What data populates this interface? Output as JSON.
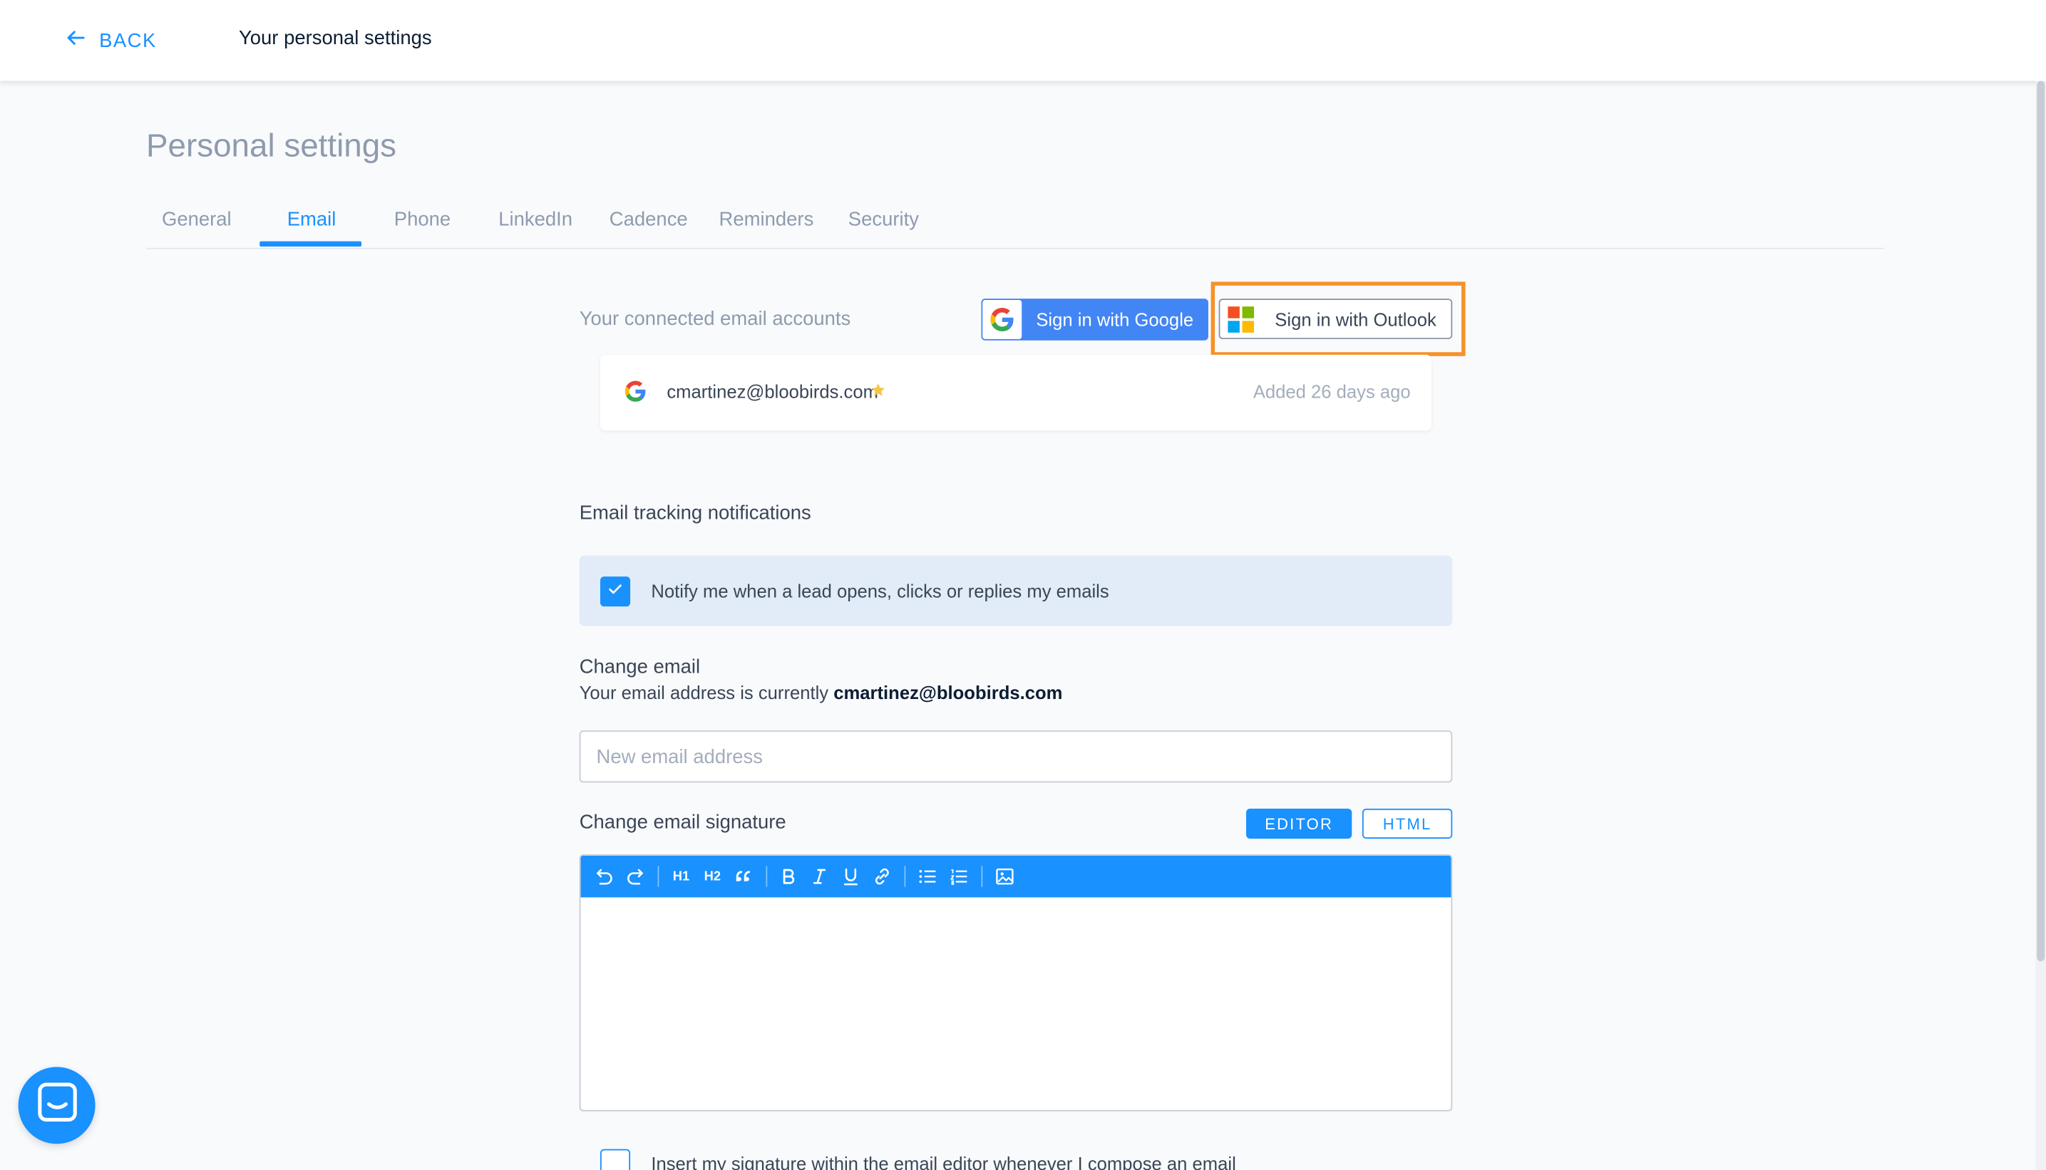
{
  "topbar": {
    "back_label": "BACK",
    "title": "Your personal settings"
  },
  "page": {
    "title": "Personal settings"
  },
  "tabs": [
    {
      "label": "General",
      "active": false
    },
    {
      "label": "Email",
      "active": true
    },
    {
      "label": "Phone",
      "active": false
    },
    {
      "label": "LinkedIn",
      "active": false
    },
    {
      "label": "Cadence",
      "active": false
    },
    {
      "label": "Reminders",
      "active": false
    },
    {
      "label": "Security",
      "active": false
    }
  ],
  "connected": {
    "label": "Your connected email accounts",
    "google_button": "Sign in with Google",
    "outlook_button": "Sign in with Outlook",
    "accounts": [
      {
        "email": "cmartinez@bloobirds.com",
        "added": "Added 26 days ago",
        "provider": "google-icon",
        "default": true
      }
    ]
  },
  "tracking": {
    "heading": "Email tracking notifications",
    "notify_label": "Notify me when a lead opens, clicks or replies my emails",
    "notify_checked": true
  },
  "change_email": {
    "heading": "Change email",
    "current_prefix": "Your email address is currently",
    "current_email": "cmartinez@bloobirds.com",
    "placeholder": "New email address",
    "value": ""
  },
  "signature": {
    "heading": "Change email signature",
    "editor_button": "EDITOR",
    "html_button": "HTML",
    "mode": "EDITOR",
    "toolbar": [
      "undo-icon",
      "redo-icon",
      "h1-icon",
      "h2-icon",
      "quote-icon",
      "bold-icon",
      "italic-icon",
      "underline-icon",
      "link-icon",
      "bullet-list-icon",
      "numbered-list-icon",
      "image-icon"
    ],
    "h1_label": "H1",
    "h2_label": "H2",
    "insert_label": "Insert my signature within the email editor whenever I compose an email",
    "insert_checked": false
  },
  "colors": {
    "accent": "#1991ff",
    "google_blue": "#4285f4",
    "highlight_orange": "#f5922b",
    "notify_bg": "#e1ecf8"
  }
}
